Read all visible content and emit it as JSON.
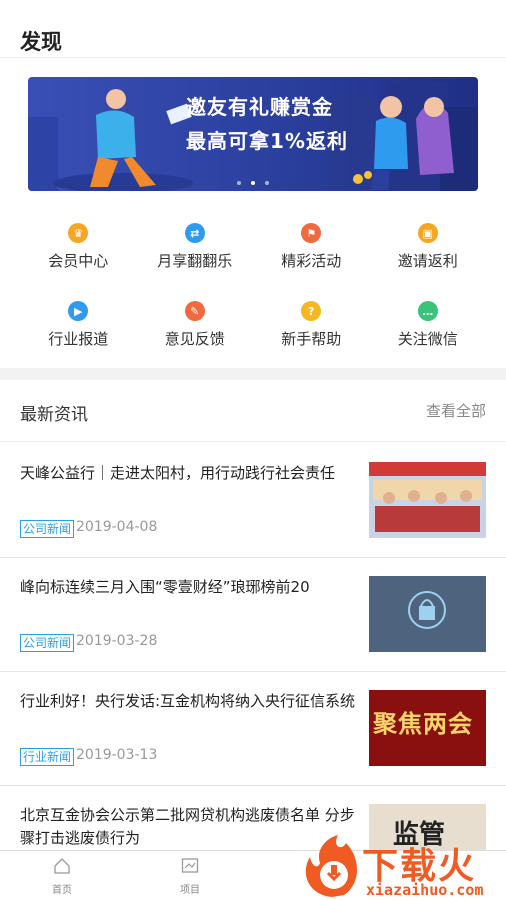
{
  "header": {
    "title": "发现"
  },
  "banner": {
    "line1": "邀友有礼赚赏金",
    "line2": "最高可拿1%返利",
    "dots": 3,
    "active_dot": 2
  },
  "grid": [
    {
      "label": "会员中心",
      "icon": "crown-icon",
      "color": "#f5a623"
    },
    {
      "label": "月享翻翻乐",
      "icon": "swap-icon",
      "color": "#2f9bef"
    },
    {
      "label": "精彩活动",
      "icon": "flag-icon",
      "color": "#f06a3f"
    },
    {
      "label": "邀请返利",
      "icon": "gift-icon",
      "color": "#f5a623"
    },
    {
      "label": "行业报道",
      "icon": "video-icon",
      "color": "#2f9bef"
    },
    {
      "label": "意见反馈",
      "icon": "pencil-icon",
      "color": "#f06a3f"
    },
    {
      "label": "新手帮助",
      "icon": "question-icon",
      "color": "#f5b823"
    },
    {
      "label": "关注微信",
      "icon": "wechat-icon",
      "color": "#38c47a"
    }
  ],
  "news": {
    "title": "最新资讯",
    "more": "查看全部",
    "items": [
      {
        "title": "天峰公益行｜走进太阳村，用行动践行社会责任",
        "tag": "公司新闻",
        "date": "2019-04-08"
      },
      {
        "title": "峰向标连续三月入围“零壹财经”琅琊榜前20",
        "tag": "公司新闻",
        "date": "2019-03-28"
      },
      {
        "title": "行业利好！央行发话:互金机构将纳入央行征信系统",
        "tag": "行业新闻",
        "date": "2019-03-13"
      },
      {
        "title": "北京互金协会公示第二批网贷机构逃废债名单 分步骤打击逃废债行为",
        "tag": "",
        "date": ""
      }
    ]
  },
  "thumbs": {
    "third_text": "聚焦两会",
    "fourth_text": "监管"
  },
  "nav": {
    "home": "首页",
    "project": "项目"
  },
  "watermark": {
    "brand": "下载火",
    "url": "xiazaihuo.com"
  }
}
